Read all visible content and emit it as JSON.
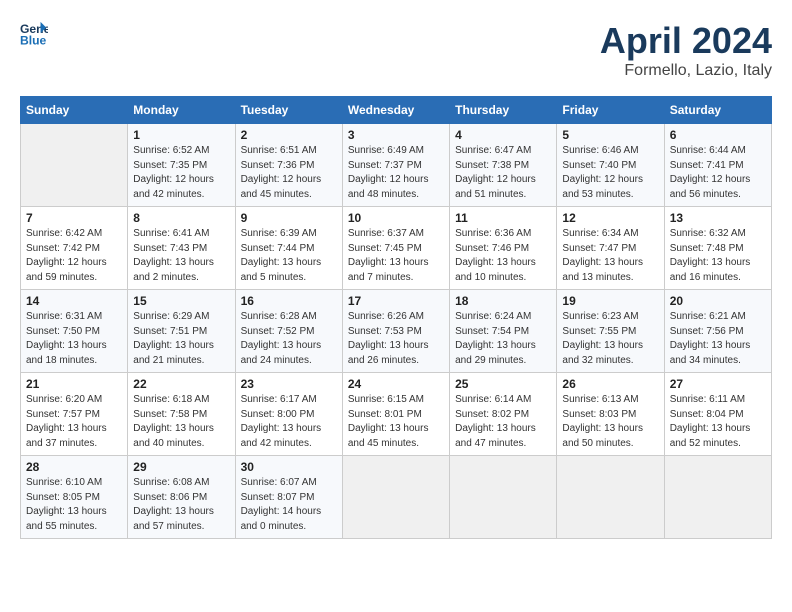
{
  "header": {
    "logo_line1": "General",
    "logo_line2": "Blue",
    "month": "April 2024",
    "location": "Formello, Lazio, Italy"
  },
  "weekdays": [
    "Sunday",
    "Monday",
    "Tuesday",
    "Wednesday",
    "Thursday",
    "Friday",
    "Saturday"
  ],
  "weeks": [
    [
      {
        "day": "",
        "empty": true
      },
      {
        "day": "1",
        "sunrise": "Sunrise: 6:52 AM",
        "sunset": "Sunset: 7:35 PM",
        "daylight": "Daylight: 12 hours and 42 minutes."
      },
      {
        "day": "2",
        "sunrise": "Sunrise: 6:51 AM",
        "sunset": "Sunset: 7:36 PM",
        "daylight": "Daylight: 12 hours and 45 minutes."
      },
      {
        "day": "3",
        "sunrise": "Sunrise: 6:49 AM",
        "sunset": "Sunset: 7:37 PM",
        "daylight": "Daylight: 12 hours and 48 minutes."
      },
      {
        "day": "4",
        "sunrise": "Sunrise: 6:47 AM",
        "sunset": "Sunset: 7:38 PM",
        "daylight": "Daylight: 12 hours and 51 minutes."
      },
      {
        "day": "5",
        "sunrise": "Sunrise: 6:46 AM",
        "sunset": "Sunset: 7:40 PM",
        "daylight": "Daylight: 12 hours and 53 minutes."
      },
      {
        "day": "6",
        "sunrise": "Sunrise: 6:44 AM",
        "sunset": "Sunset: 7:41 PM",
        "daylight": "Daylight: 12 hours and 56 minutes."
      }
    ],
    [
      {
        "day": "7",
        "sunrise": "Sunrise: 6:42 AM",
        "sunset": "Sunset: 7:42 PM",
        "daylight": "Daylight: 12 hours and 59 minutes."
      },
      {
        "day": "8",
        "sunrise": "Sunrise: 6:41 AM",
        "sunset": "Sunset: 7:43 PM",
        "daylight": "Daylight: 13 hours and 2 minutes."
      },
      {
        "day": "9",
        "sunrise": "Sunrise: 6:39 AM",
        "sunset": "Sunset: 7:44 PM",
        "daylight": "Daylight: 13 hours and 5 minutes."
      },
      {
        "day": "10",
        "sunrise": "Sunrise: 6:37 AM",
        "sunset": "Sunset: 7:45 PM",
        "daylight": "Daylight: 13 hours and 7 minutes."
      },
      {
        "day": "11",
        "sunrise": "Sunrise: 6:36 AM",
        "sunset": "Sunset: 7:46 PM",
        "daylight": "Daylight: 13 hours and 10 minutes."
      },
      {
        "day": "12",
        "sunrise": "Sunrise: 6:34 AM",
        "sunset": "Sunset: 7:47 PM",
        "daylight": "Daylight: 13 hours and 13 minutes."
      },
      {
        "day": "13",
        "sunrise": "Sunrise: 6:32 AM",
        "sunset": "Sunset: 7:48 PM",
        "daylight": "Daylight: 13 hours and 16 minutes."
      }
    ],
    [
      {
        "day": "14",
        "sunrise": "Sunrise: 6:31 AM",
        "sunset": "Sunset: 7:50 PM",
        "daylight": "Daylight: 13 hours and 18 minutes."
      },
      {
        "day": "15",
        "sunrise": "Sunrise: 6:29 AM",
        "sunset": "Sunset: 7:51 PM",
        "daylight": "Daylight: 13 hours and 21 minutes."
      },
      {
        "day": "16",
        "sunrise": "Sunrise: 6:28 AM",
        "sunset": "Sunset: 7:52 PM",
        "daylight": "Daylight: 13 hours and 24 minutes."
      },
      {
        "day": "17",
        "sunrise": "Sunrise: 6:26 AM",
        "sunset": "Sunset: 7:53 PM",
        "daylight": "Daylight: 13 hours and 26 minutes."
      },
      {
        "day": "18",
        "sunrise": "Sunrise: 6:24 AM",
        "sunset": "Sunset: 7:54 PM",
        "daylight": "Daylight: 13 hours and 29 minutes."
      },
      {
        "day": "19",
        "sunrise": "Sunrise: 6:23 AM",
        "sunset": "Sunset: 7:55 PM",
        "daylight": "Daylight: 13 hours and 32 minutes."
      },
      {
        "day": "20",
        "sunrise": "Sunrise: 6:21 AM",
        "sunset": "Sunset: 7:56 PM",
        "daylight": "Daylight: 13 hours and 34 minutes."
      }
    ],
    [
      {
        "day": "21",
        "sunrise": "Sunrise: 6:20 AM",
        "sunset": "Sunset: 7:57 PM",
        "daylight": "Daylight: 13 hours and 37 minutes."
      },
      {
        "day": "22",
        "sunrise": "Sunrise: 6:18 AM",
        "sunset": "Sunset: 7:58 PM",
        "daylight": "Daylight: 13 hours and 40 minutes."
      },
      {
        "day": "23",
        "sunrise": "Sunrise: 6:17 AM",
        "sunset": "Sunset: 8:00 PM",
        "daylight": "Daylight: 13 hours and 42 minutes."
      },
      {
        "day": "24",
        "sunrise": "Sunrise: 6:15 AM",
        "sunset": "Sunset: 8:01 PM",
        "daylight": "Daylight: 13 hours and 45 minutes."
      },
      {
        "day": "25",
        "sunrise": "Sunrise: 6:14 AM",
        "sunset": "Sunset: 8:02 PM",
        "daylight": "Daylight: 13 hours and 47 minutes."
      },
      {
        "day": "26",
        "sunrise": "Sunrise: 6:13 AM",
        "sunset": "Sunset: 8:03 PM",
        "daylight": "Daylight: 13 hours and 50 minutes."
      },
      {
        "day": "27",
        "sunrise": "Sunrise: 6:11 AM",
        "sunset": "Sunset: 8:04 PM",
        "daylight": "Daylight: 13 hours and 52 minutes."
      }
    ],
    [
      {
        "day": "28",
        "sunrise": "Sunrise: 6:10 AM",
        "sunset": "Sunset: 8:05 PM",
        "daylight": "Daylight: 13 hours and 55 minutes."
      },
      {
        "day": "29",
        "sunrise": "Sunrise: 6:08 AM",
        "sunset": "Sunset: 8:06 PM",
        "daylight": "Daylight: 13 hours and 57 minutes."
      },
      {
        "day": "30",
        "sunrise": "Sunrise: 6:07 AM",
        "sunset": "Sunset: 8:07 PM",
        "daylight": "Daylight: 14 hours and 0 minutes."
      },
      {
        "day": "",
        "empty": true
      },
      {
        "day": "",
        "empty": true
      },
      {
        "day": "",
        "empty": true
      },
      {
        "day": "",
        "empty": true
      }
    ]
  ]
}
